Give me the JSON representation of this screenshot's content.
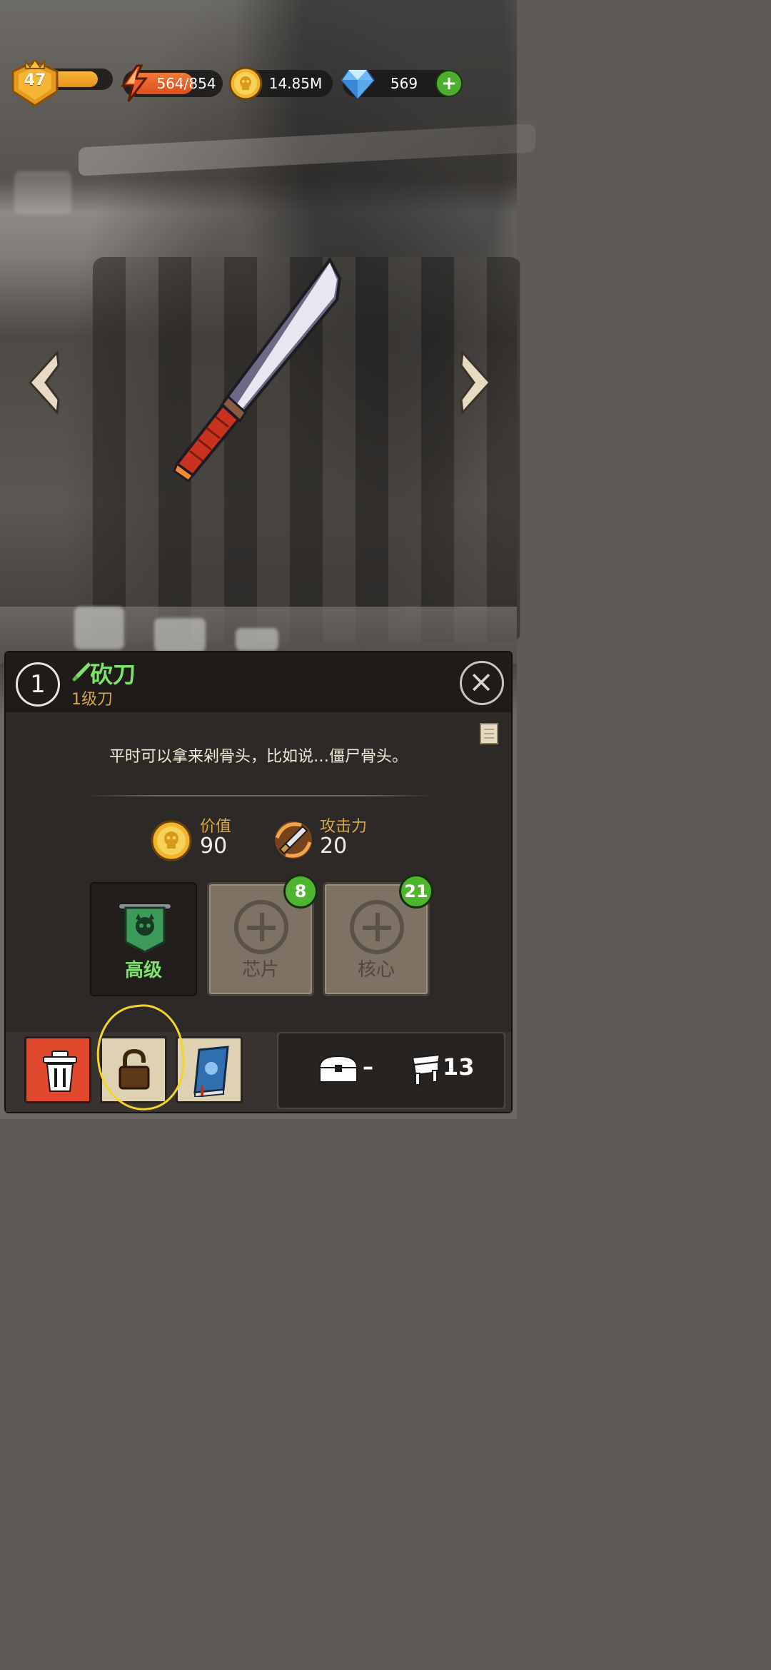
{
  "hud": {
    "level": "47",
    "level_progress": 0.8,
    "energy": "564/854",
    "energy_progress": 0.66,
    "coins": "14.85M",
    "gems": "569",
    "add_label": "+"
  },
  "item": {
    "index": "1",
    "name": "砍刀",
    "subtitle": "1级刀",
    "description": "平时可以拿来剁骨头，比如说…僵尸骨头。",
    "stats": {
      "value_label": "价值",
      "value": "90",
      "attack_label": "攻击力",
      "attack": "20"
    },
    "slots": [
      {
        "label": "高级"
      },
      {
        "label": "芯片",
        "badge": "8"
      },
      {
        "label": "核心",
        "badge": "21"
      }
    ]
  },
  "bottom": {
    "chest_value": "–",
    "decoration_count": "13"
  },
  "colors": {
    "name_green": "#7ee36a",
    "label_gold": "#d6a649",
    "badge_green": "#4eb52f",
    "trash_red": "#e0482d",
    "highlight_yellow": "#f3d52a"
  },
  "icons": [
    "level-shield-icon",
    "lightning-icon",
    "skull-coin-icon",
    "diamond-icon",
    "plus-icon",
    "left-arrow-icon",
    "right-arrow-icon",
    "machete-icon",
    "close-icon",
    "scroll-icon",
    "demon-banner-icon",
    "sword-attack-icon",
    "trash-icon",
    "lock-icon",
    "book-icon",
    "chest-icon",
    "decoration-icon"
  ]
}
